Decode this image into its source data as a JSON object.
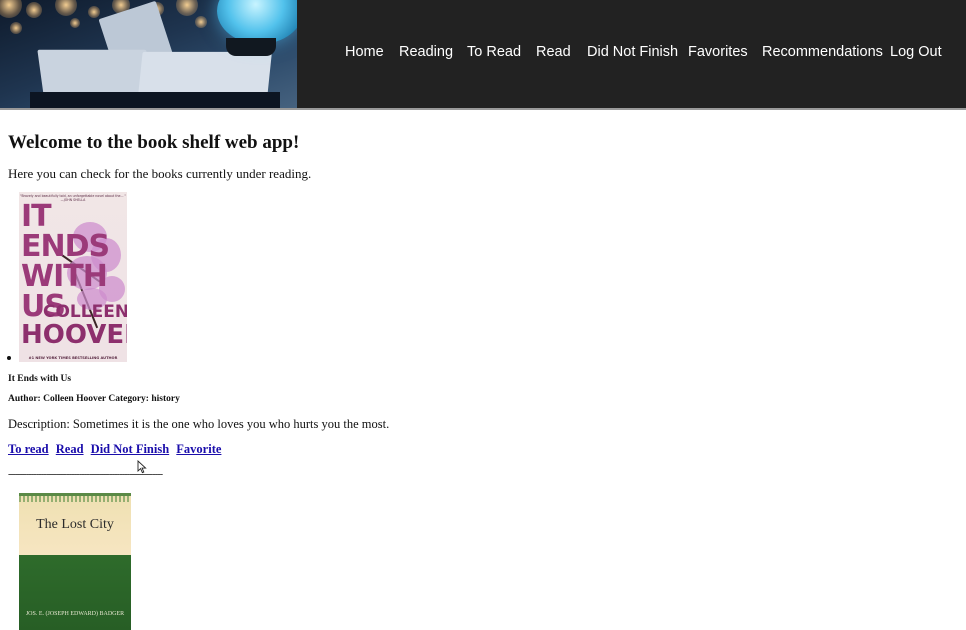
{
  "nav": {
    "items": [
      "Home",
      "Reading",
      "To Read",
      "Read",
      "Did Not Finish",
      "Favorites",
      "Recommendations",
      "Log Out"
    ]
  },
  "main": {
    "heading": "Welcome to the book shelf web app!",
    "intro": "Here you can check for the books currently under reading."
  },
  "books": [
    {
      "title": "It Ends with Us",
      "meta": "Author: Colleen Hoover Category: history",
      "description": "Description: Sometimes it is the one who loves you who hurts you the most.",
      "cover": {
        "tagline": "\"Bravely and beautifully told, an unforgettable novel about the... \" —JOHN SHELLA",
        "title_line1": "IT ENDS",
        "title_line2": "WITH",
        "title_line3": "US",
        "author_first": "COLLEEN",
        "author_last": "HOOVER",
        "bottom_text": "#1 NEW YORK TIMES BESTSELLING AUTHOR"
      }
    },
    {
      "cover": {
        "title": "The Lost City",
        "author": "JOS. E. (JOSEPH EDWARD) BADGER"
      }
    }
  ],
  "actions": [
    "To read",
    "Read",
    "Did Not Finish",
    "Favorite"
  ],
  "separator": "-------------------------------------------------------------"
}
